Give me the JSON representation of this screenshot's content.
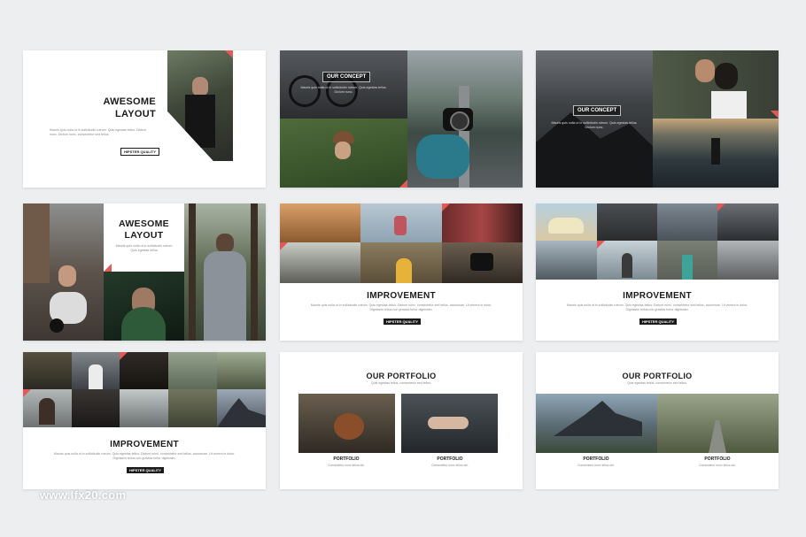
{
  "watermark": "www.lfx20.com",
  "slide1": {
    "title_line1": "AWESOME",
    "title_line2": "LAYOUT",
    "body": "Mauris quis nulla ut in sollicitudin rutrum. Quis egestas tellus. Dictum nunc. Dictum nunc, consectetur sed tellus.",
    "tag": "HIPSTER QUALITY"
  },
  "slide2": {
    "label": "OUR CONCEPT",
    "body": "Mauris quis nulla ut in sollicitudin rutrum. Quis egestas tellus. Dictum nunc."
  },
  "slide3": {
    "label": "OUR CONCEPT",
    "body": "Mauris quis nulla ut in sollicitudin rutrum. Quis egestas tellus. Dictum nunc."
  },
  "slide4": {
    "title_line1": "AWESOME",
    "title_line2": "LAYOUT",
    "body": "Mauris quis nulla ut in sollicitudin rutrum. Quis egestas tellus."
  },
  "slide5": {
    "title": "IMPROVEMENT",
    "body": "Mauris quis nulla ut in sollicitudin rutrum. Quis egestas tellus. Dictum nunc, consectetur sed tellus, accumsan. Ut viverra in dolor. Dignissim tellus non gravida tortor dignissim.",
    "tag": "HIPSTER QUALITY"
  },
  "slide6": {
    "title": "IMPROVEMENT",
    "body": "Mauris quis nulla ut in sollicitudin rutrum. Quis egestas tellus. Dictum nunc, consectetur sed tellus, accumsan. Ut viverra in dolor. Dignissim tellus non gravida tortor dignissim.",
    "tag": "HIPSTER QUALITY"
  },
  "slide7": {
    "title": "IMPROVEMENT",
    "body": "Mauris quis nulla ut in sollicitudin rutrum. Quis egestas tellus. Dictum nunc, consectetur sed tellus, accumsan. Ut viverra in dolor. Dignissim tellus non gravida tortor dignissim.",
    "tag": "HIPSTER QUALITY"
  },
  "slide8": {
    "title": "OUR PORTFOLIO",
    "sub": "Quis egestas tellus, consectetur sed tellus.",
    "item1_title": "PORTFOLIO",
    "item1_body": "Consectetur nunc tellus dui.",
    "item2_title": "PORTFOLIO",
    "item2_body": "Consectetur nunc tellus dui."
  },
  "slide9": {
    "title": "OUR PORTFOLIO",
    "sub": "Quis egestas tellus, consectetur sed tellus.",
    "item1_title": "PORTFOLIO",
    "item1_body": "Consectetur nunc tellus dui.",
    "item2_title": "PORTFOLIO",
    "item2_body": "Consectetur nunc tellus dui."
  },
  "colors": {
    "accent": "#e05a5a",
    "background": "#eceef0",
    "dark": "#1b1b1b"
  }
}
